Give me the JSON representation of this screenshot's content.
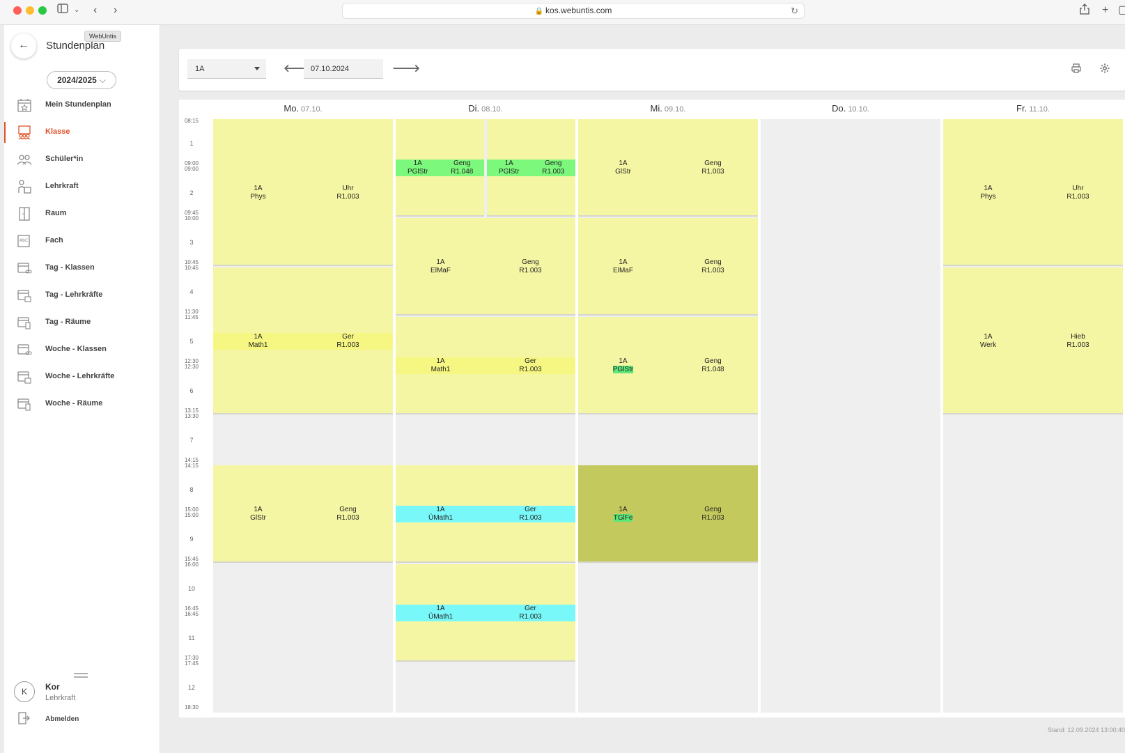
{
  "browser": {
    "url": "kos.webuntis.com"
  },
  "sidebar": {
    "title": "Stundenplan",
    "tooltip": "WebUntis",
    "school_year": "2024/2025",
    "items": [
      {
        "label": "Mein Stundenplan",
        "icon": "calendar-star-icon"
      },
      {
        "label": "Klasse",
        "icon": "class-icon",
        "active": true
      },
      {
        "label": "Schüler*in",
        "icon": "students-icon"
      },
      {
        "label": "Lehrkraft",
        "icon": "teacher-icon"
      },
      {
        "label": "Raum",
        "icon": "door-icon"
      },
      {
        "label": "Fach",
        "icon": "subject-icon"
      },
      {
        "label": "Tag - Klassen",
        "icon": "calendar-class-icon"
      },
      {
        "label": "Tag - Lehrkräfte",
        "icon": "calendar-teacher-icon"
      },
      {
        "label": "Tag - Räume",
        "icon": "calendar-room-icon"
      },
      {
        "label": "Woche - Klassen",
        "icon": "calendar-class-icon"
      },
      {
        "label": "Woche - Lehrkräfte",
        "icon": "calendar-teacher-icon"
      },
      {
        "label": "Woche - Räume",
        "icon": "calendar-room-icon"
      }
    ],
    "user": {
      "initial": "K",
      "name": "Kor",
      "role": "Lehrkraft"
    },
    "logout_label": "Abmelden"
  },
  "toolbar": {
    "class_value": "1A",
    "date_value": "07.10.2024"
  },
  "days": [
    {
      "name": "Mo.",
      "date": "07.10."
    },
    {
      "name": "Di.",
      "date": "08.10."
    },
    {
      "name": "Mi.",
      "date": "09.10."
    },
    {
      "name": "Do.",
      "date": "10.10."
    },
    {
      "name": "Fr.",
      "date": "11.10."
    }
  ],
  "periods": [
    {
      "num": "1",
      "start": "08:15",
      "end": "09:00"
    },
    {
      "num": "2",
      "start": "09:00",
      "end": "09:45"
    },
    {
      "num": "3",
      "start": "10:00",
      "end": "10:45"
    },
    {
      "num": "4",
      "start": "10:45",
      "end": "11:30"
    },
    {
      "num": "5",
      "start": "11:45",
      "end": "12:30"
    },
    {
      "num": "6",
      "start": "12:30",
      "end": "13:15"
    },
    {
      "num": "7",
      "start": "13:30",
      "end": "14:15"
    },
    {
      "num": "8",
      "start": "14:15",
      "end": "15:00"
    },
    {
      "num": "9",
      "start": "15:00",
      "end": "15:45"
    },
    {
      "num": "10",
      "start": "16:00",
      "end": "16:45"
    },
    {
      "num": "11",
      "start": "16:45",
      "end": "17:30"
    },
    {
      "num": "12",
      "start": "17:45",
      "end": "18:30"
    }
  ],
  "lessons": [
    {
      "day": 0,
      "from": 1,
      "to": 3,
      "klass": "1A",
      "subject": "Phys",
      "teacher": "Uhr",
      "room": "R1.003"
    },
    {
      "day": 0,
      "from": 4,
      "to": 6,
      "klass": "1A",
      "subject": "Math1",
      "teacher": "Ger",
      "room": "R1.003",
      "band": "yellow"
    },
    {
      "day": 0,
      "from": 8,
      "to": 9,
      "klass": "1A",
      "subject": "GlStr",
      "teacher": "Geng",
      "room": "R1.003"
    },
    {
      "day": 1,
      "from": 1,
      "to": 2,
      "half": 0,
      "klass": "1A",
      "subject": "PGlStr",
      "teacher": "Geng",
      "room": "R1.048",
      "band": "green"
    },
    {
      "day": 1,
      "from": 1,
      "to": 2,
      "half": 1,
      "klass": "1A",
      "subject": "PGlStr",
      "teacher": "Geng",
      "room": "R1.003",
      "band": "green"
    },
    {
      "day": 1,
      "from": 3,
      "to": 4,
      "klass": "1A",
      "subject": "ElMaF",
      "teacher": "Geng",
      "room": "R1.003"
    },
    {
      "day": 1,
      "from": 5,
      "to": 6,
      "klass": "1A",
      "subject": "Math1",
      "teacher": "Ger",
      "room": "R1.003",
      "band": "yellow"
    },
    {
      "day": 1,
      "from": 8,
      "to": 9,
      "klass": "1A",
      "subject": "ÜMath1",
      "teacher": "Ger",
      "room": "R1.003",
      "band": "cyan"
    },
    {
      "day": 1,
      "from": 10,
      "to": 11,
      "klass": "1A",
      "subject": "ÜMath1",
      "teacher": "Ger",
      "room": "R1.003",
      "band": "cyan"
    },
    {
      "day": 2,
      "from": 1,
      "to": 2,
      "klass": "1A",
      "subject": "GlStr",
      "teacher": "Geng",
      "room": "R1.003"
    },
    {
      "day": 2,
      "from": 3,
      "to": 4,
      "klass": "1A",
      "subject": "ElMaF",
      "teacher": "Geng",
      "room": "R1.003"
    },
    {
      "day": 2,
      "from": 5,
      "to": 6,
      "klass": "1A",
      "subject": "PGlStr",
      "teacher": "Geng",
      "room": "R1.048",
      "subject_highlight": true
    },
    {
      "day": 2,
      "from": 8,
      "to": 9,
      "klass": "1A",
      "subject": "TGlFe",
      "teacher": "Geng",
      "room": "R1.003",
      "subject_highlight": true,
      "olive": true
    },
    {
      "day": 4,
      "from": 1,
      "to": 3,
      "klass": "1A",
      "subject": "Phys",
      "teacher": "Uhr",
      "room": "R1.003"
    },
    {
      "day": 4,
      "from": 4,
      "to": 6,
      "klass": "1A",
      "subject": "Werk",
      "teacher": "Hieb",
      "room": "R1.003"
    }
  ],
  "colors": {
    "lesson": "#f5f6a3",
    "band_green": "#7cf97c",
    "band_yellow": "#f6f783",
    "band_cyan": "#78f8f8",
    "olive": "#c3c95d",
    "accent": "#e0512b"
  },
  "footer": {
    "stand": "Stand: 12.09.2024 13:00:40"
  }
}
